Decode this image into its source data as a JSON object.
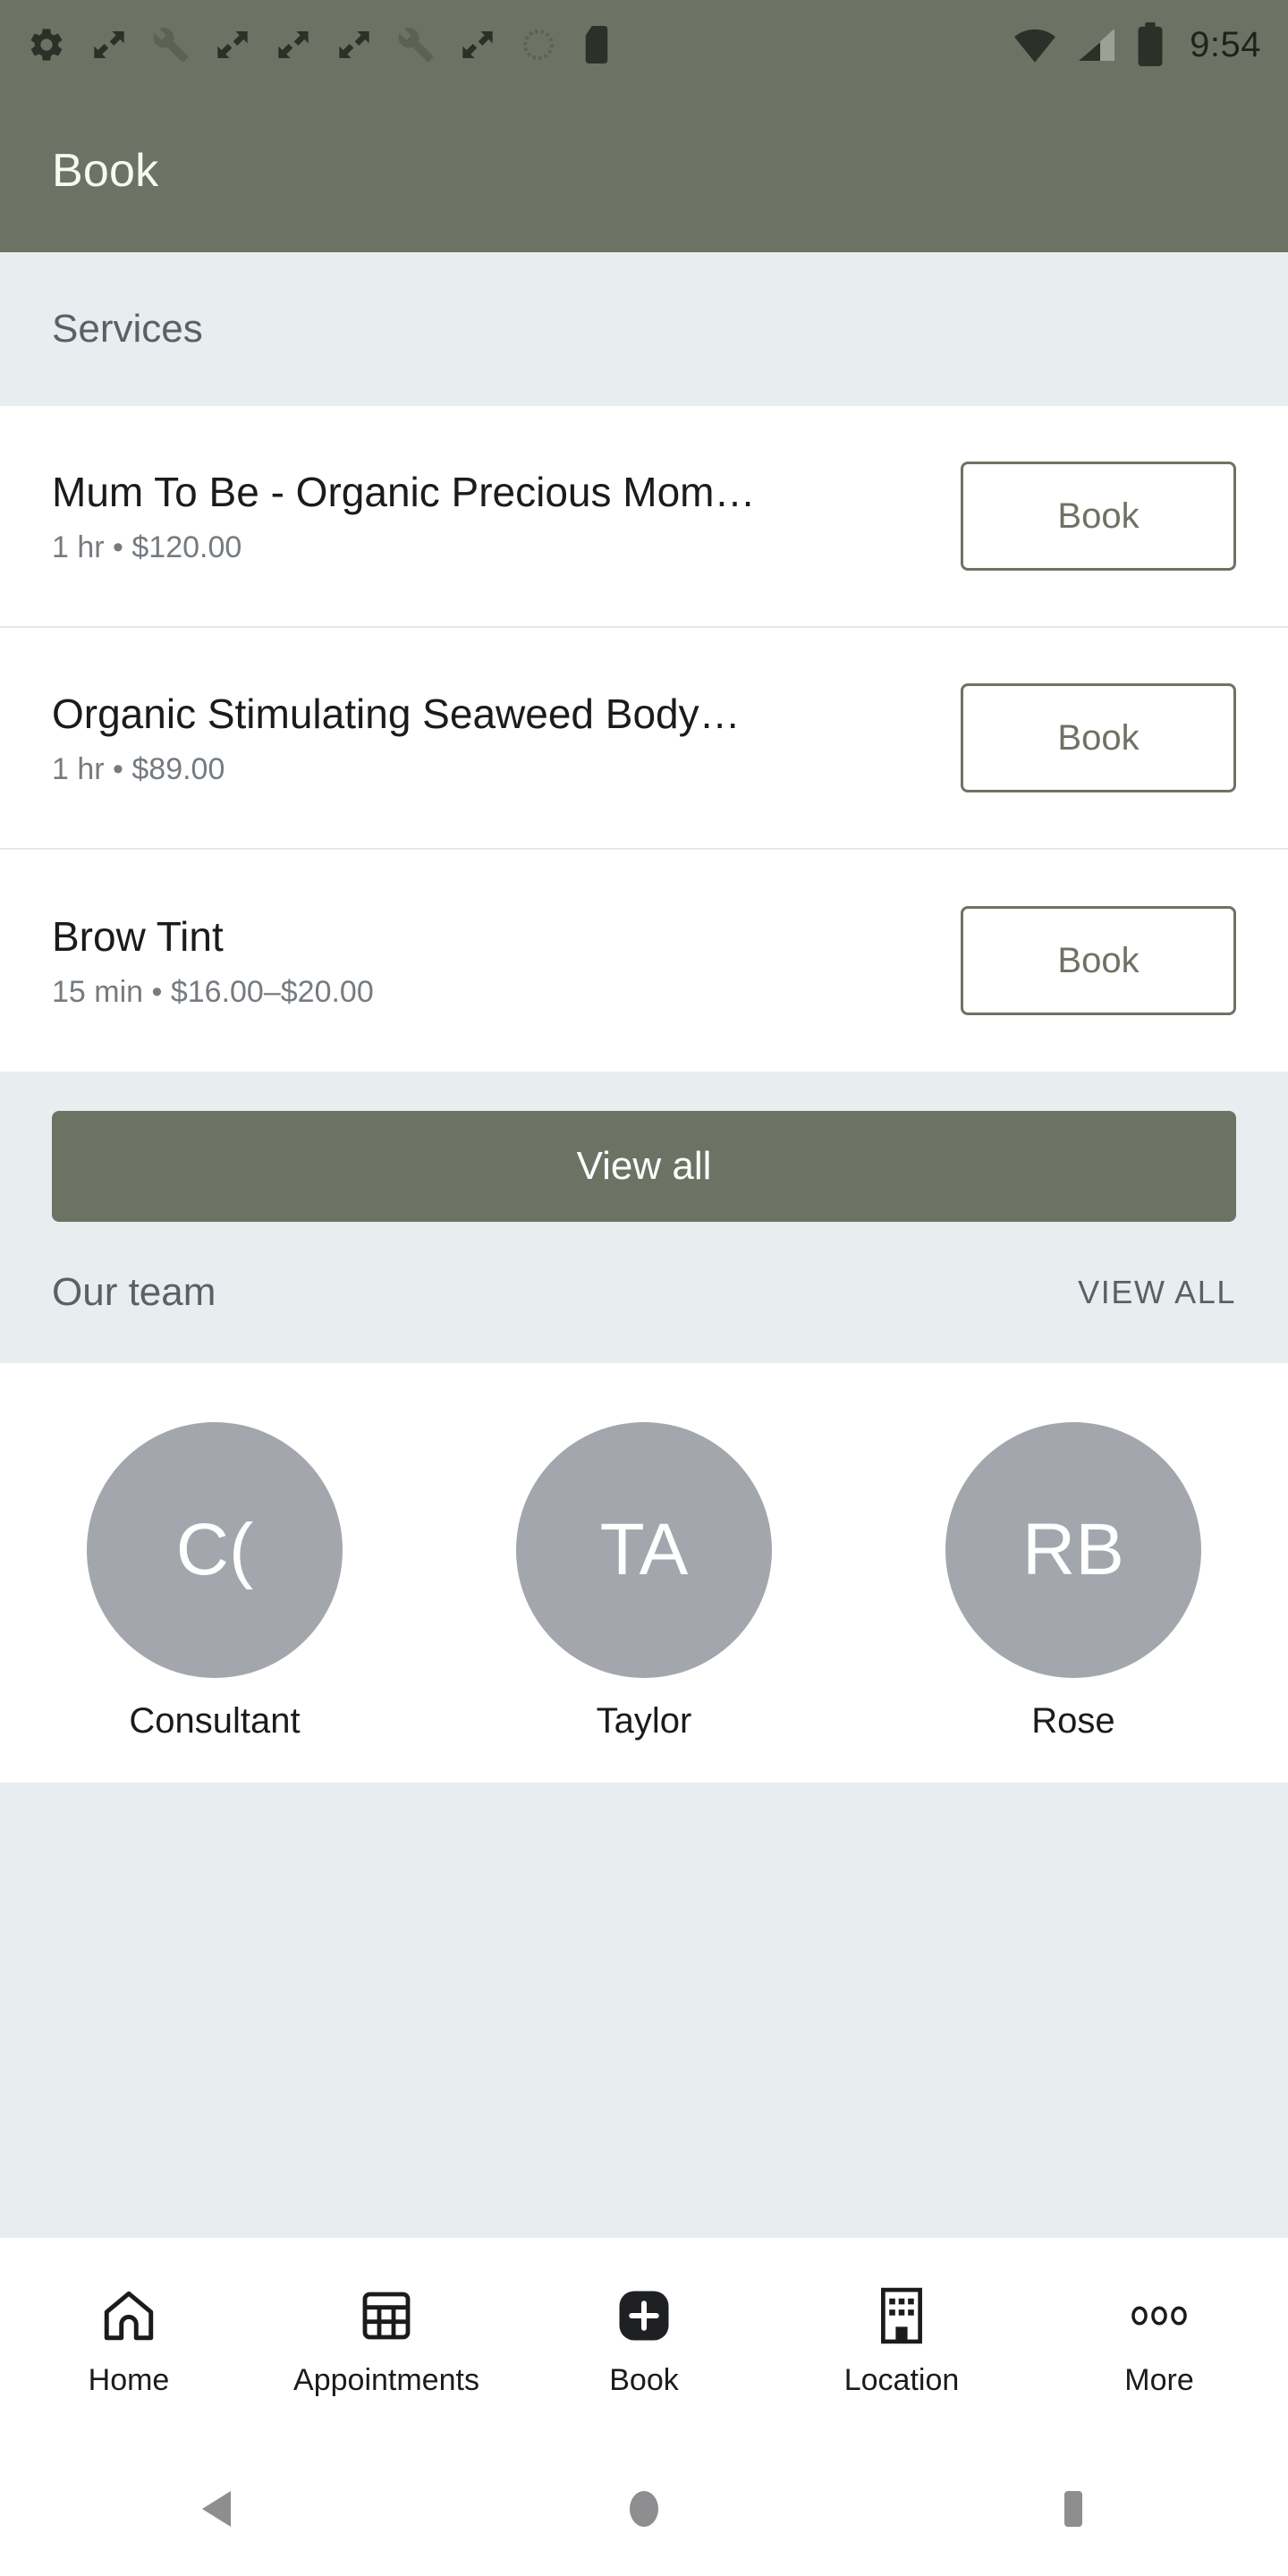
{
  "status_bar": {
    "time": "9:54",
    "left_icons": [
      "gear-icon",
      "resize-icon",
      "wrench-icon",
      "resize-icon",
      "resize-icon",
      "resize-icon",
      "wrench-icon",
      "resize-icon",
      "circle-dotted-icon",
      "sd-card-icon"
    ],
    "right_icons": [
      "wifi-icon",
      "cellular-signal-icon",
      "battery-icon"
    ]
  },
  "app_bar": {
    "title": "Book"
  },
  "services_section": {
    "header": "Services",
    "items": [
      {
        "name": "Mum To Be - Organic Precious Mom…",
        "meta": "1 hr • $120.00",
        "action": "Book"
      },
      {
        "name": "Organic Stimulating Seaweed Body…",
        "meta": "1 hr • $89.00",
        "action": "Book"
      },
      {
        "name": "Brow Tint",
        "meta": "15 min • $16.00–$20.00",
        "action": "Book"
      }
    ],
    "view_all_label": "View all"
  },
  "team_section": {
    "header": "Our team",
    "view_all_label": "VIEW ALL",
    "members": [
      {
        "initials": "C(",
        "name": "Consultant"
      },
      {
        "initials": "TA",
        "name": "Taylor"
      },
      {
        "initials": "RB",
        "name": "Rose"
      }
    ]
  },
  "bottom_nav": {
    "items": [
      {
        "label": "Home",
        "icon": "home-icon"
      },
      {
        "label": "Appointments",
        "icon": "calendar-grid-icon"
      },
      {
        "label": "Book",
        "icon": "plus-square-icon"
      },
      {
        "label": "Location",
        "icon": "building-icon"
      },
      {
        "label": "More",
        "icon": "more-dots-icon"
      }
    ]
  },
  "android_nav": {
    "buttons": [
      {
        "name": "back",
        "icon": "triangle-back-icon"
      },
      {
        "name": "home",
        "icon": "circle-home-icon"
      },
      {
        "name": "recents",
        "icon": "square-recents-icon"
      }
    ]
  },
  "colors": {
    "brand": "#6d7364",
    "section_bg": "#e8edef",
    "avatar_bg": "#a3a7ad",
    "status_icon": "#2c3028"
  }
}
